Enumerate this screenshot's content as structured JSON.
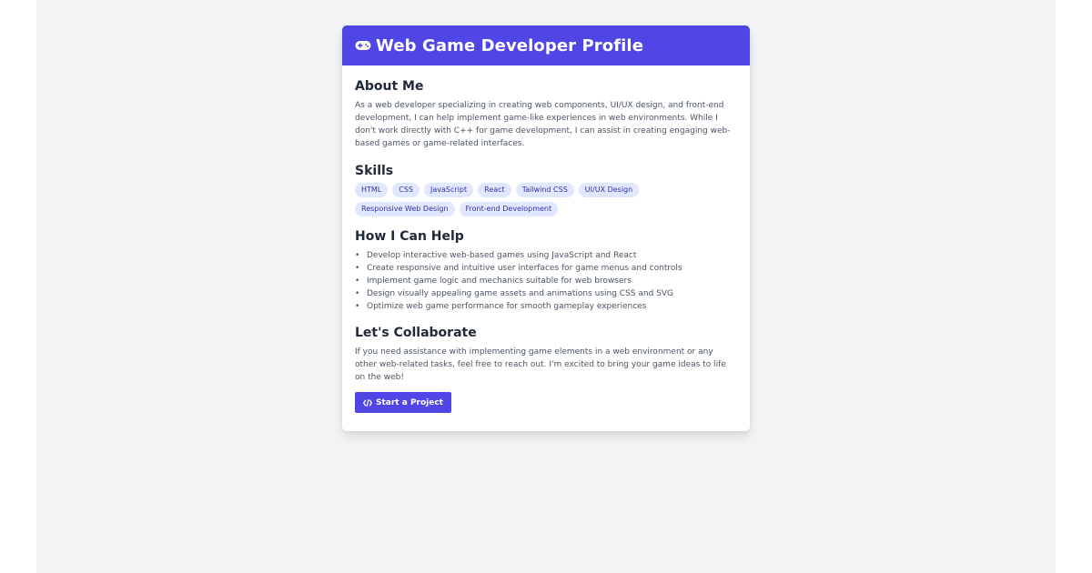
{
  "header": {
    "title": "Web Game Developer Profile",
    "icon": "gamepad-icon",
    "accent_color": "#4f46e5"
  },
  "about": {
    "heading": "About Me",
    "text": "As a web developer specializing in creating web components, UI/UX design, and front-end development, I can help implement game-like experiences in web environments. While I don't work directly with C++ for game development, I can assist in creating engaging web-based games or game-related interfaces."
  },
  "skills": {
    "heading": "Skills",
    "items": [
      "HTML",
      "CSS",
      "JavaScript",
      "React",
      "Tailwind CSS",
      "UI/UX Design",
      "Responsive Web Design",
      "Front-end Development"
    ],
    "tag_color": "#e0e7ff",
    "tag_text_color": "#3730a3"
  },
  "help": {
    "heading": "How I Can Help",
    "items": [
      "Develop interactive web-based games using JavaScript and React",
      "Create responsive and intuitive user interfaces for game menus and controls",
      "Implement game logic and mechanics suitable for web browsers",
      "Design visually appealing game assets and animations using CSS and SVG",
      "Optimize web game performance for smooth gameplay experiences"
    ]
  },
  "collaborate": {
    "heading": "Let's Collaborate",
    "text": "If you need assistance with implementing game elements in a web environment or any other web-related tasks, feel free to reach out. I'm excited to bring your game ideas to life on the web!",
    "button_label": "Start a Project",
    "button_icon": "code-icon"
  }
}
